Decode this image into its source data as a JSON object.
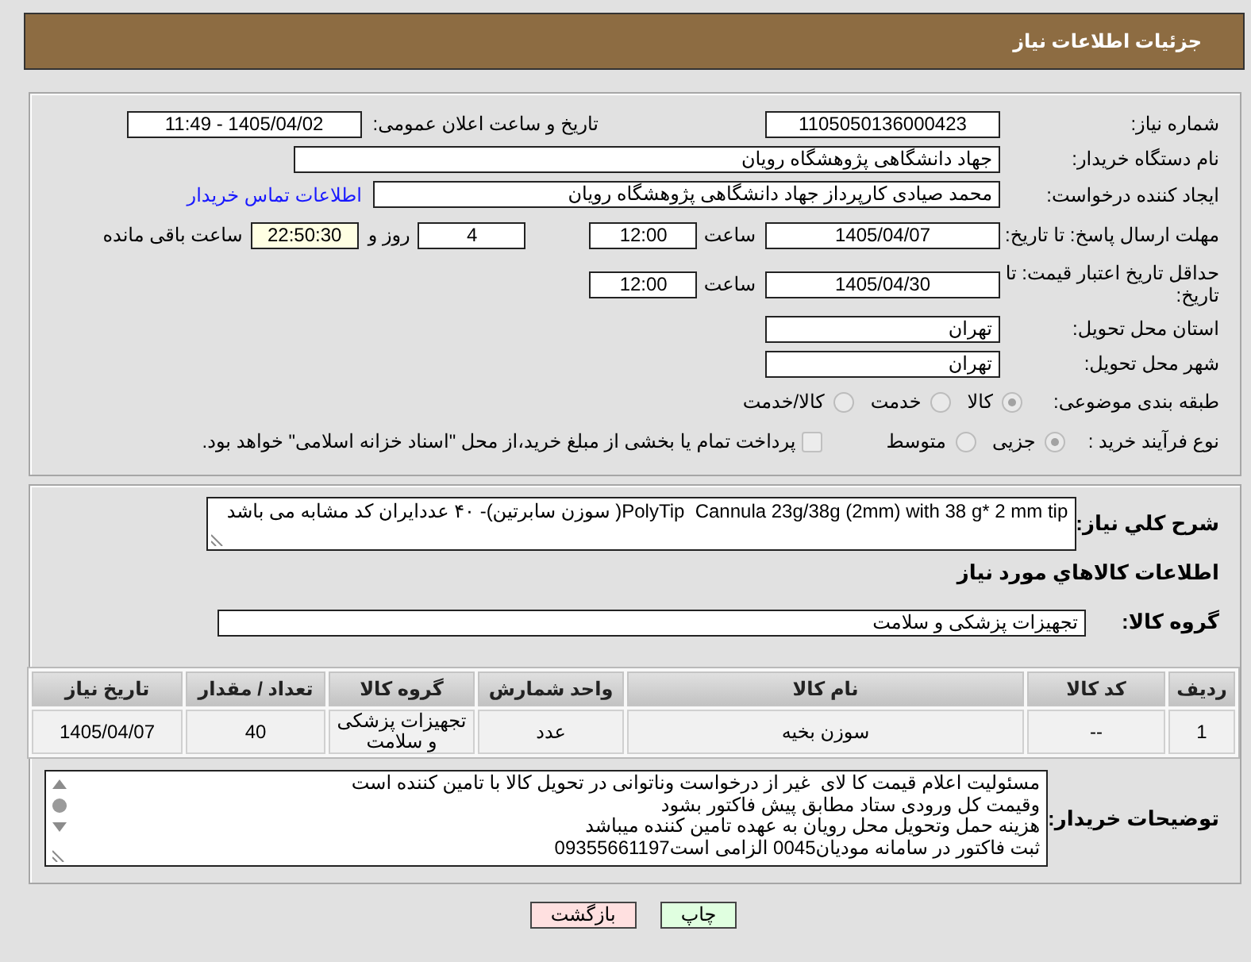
{
  "header": {
    "title": "جزئیات اطلاعات نیاز"
  },
  "details": {
    "need_number": {
      "label": "شماره نیاز:",
      "value": "1105050136000423"
    },
    "announce_datetime": {
      "label": "تاریخ و ساعت اعلان عمومی:",
      "value": "1405/04/02 - 11:49"
    },
    "buyer_org": {
      "label": "نام دستگاه خریدار:",
      "value": "جهاد دانشگاهی پژوهشگاه رویان"
    },
    "requester": {
      "label": "ایجاد کننده درخواست:",
      "value": "محمد صیادی کارپرداز جهاد دانشگاهی پژوهشگاه رویان",
      "contact_link": "اطلاعات تماس خریدار"
    },
    "response_deadline": {
      "label": "مهلت ارسال پاسخ: تا تاریخ:",
      "date": "1405/04/07",
      "time_label": "ساعت",
      "time": "12:00",
      "days": "4",
      "days_label": "روز و",
      "remaining": "22:50:30",
      "remaining_label": "ساعت باقی مانده"
    },
    "price_validity": {
      "label": "حداقل تاریخ اعتبار قیمت: تا تاریخ:",
      "date": "1405/04/30",
      "time_label": "ساعت",
      "time": "12:00"
    },
    "delivery_province": {
      "label": "استان محل تحویل:",
      "value": "تهران"
    },
    "delivery_city": {
      "label": "شهر محل تحویل:",
      "value": "تهران"
    },
    "subject_category": {
      "label": "طبقه بندی موضوعی:",
      "options": [
        {
          "label": "کالا",
          "selected": true
        },
        {
          "label": "خدمت",
          "selected": false
        },
        {
          "label": "کالا/خدمت",
          "selected": false
        }
      ]
    },
    "purchase_process": {
      "label": "نوع فرآیند خرید :",
      "options": [
        {
          "label": "جزیی",
          "selected": true
        },
        {
          "label": "متوسط",
          "selected": false
        }
      ],
      "treasury_payment": {
        "label": "پرداخت تمام یا بخشی از مبلغ خرید،از محل \"اسناد خزانه اسلامی\" خواهد بود.",
        "checked": false
      }
    }
  },
  "needs": {
    "description": {
      "label": "شرح کلي نياز:",
      "value": "PolyTip  Cannula 23g/38g (2mm) with 38 g* 2 mm tip( سوزن سابرتین)- ۴۰ عددایران کد مشابه می باشد"
    },
    "goods_heading": "اطلاعات کالاهاي مورد نياز",
    "goods_group": {
      "label": "گروه کالا:",
      "value": "تجهیزات پزشکی و سلامت"
    },
    "table": {
      "columns": [
        "ردیف",
        "کد کالا",
        "نام کالا",
        "واحد شمارش",
        "گروه کالا",
        "تعداد / مقدار",
        "تاریخ نیاز"
      ],
      "rows": [
        [
          "1",
          "--",
          "سوزن بخیه",
          "عدد",
          "تجهیزات پزشکی و سلامت",
          "40",
          "1405/04/07"
        ]
      ]
    },
    "buyer_notes": {
      "label": "توضیحات خریدار:",
      "lines": [
        "مسئولیت اعلام قیمت کا لای  غیر از درخواست وناتوانی در تحویل کالا با تامین کننده است",
        "وقیمت کل ورودی ستاد مطابق پیش فاکتور بشود",
        "هزینه حمل وتحویل محل رویان به عهده تامین کننده میباشد",
        "ثبت فاکتور در سامانه مودیان0045 الزامی است09355661197"
      ]
    }
  },
  "buttons": [
    {
      "label": "چاپ",
      "kind": "print"
    },
    {
      "label": "بازگشت",
      "kind": "back"
    }
  ]
}
